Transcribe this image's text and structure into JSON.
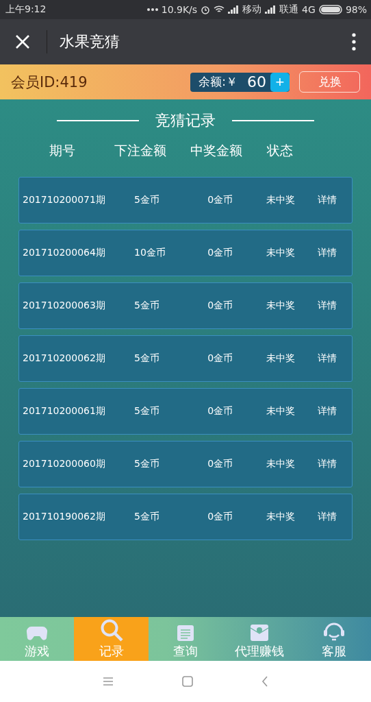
{
  "status_bar": {
    "time": "上午9:12",
    "speed": "10.9K/s",
    "carrier_1": "移动",
    "carrier_2": "联通",
    "network": "4G",
    "battery": "98%"
  },
  "header": {
    "title": "水果竞猜"
  },
  "member": {
    "id_label": "会员ID:419",
    "balance_label": "余额:￥",
    "balance": "60",
    "add": "+",
    "exchange": "兑换"
  },
  "section_title": "竞猜记录",
  "columns": [
    "期号",
    "下注金额",
    "中奖金额",
    "状态"
  ],
  "records": [
    {
      "period": "201710200071期",
      "bet": "5金币",
      "win": "0金币",
      "status": "未中奖",
      "detail": "详情"
    },
    {
      "period": "201710200064期",
      "bet": "10金币",
      "win": "0金币",
      "status": "未中奖",
      "detail": "详情"
    },
    {
      "period": "201710200063期",
      "bet": "5金币",
      "win": "0金币",
      "status": "未中奖",
      "detail": "详情"
    },
    {
      "period": "201710200062期",
      "bet": "5金币",
      "win": "0金币",
      "status": "未中奖",
      "detail": "详情"
    },
    {
      "period": "201710200061期",
      "bet": "5金币",
      "win": "0金币",
      "status": "未中奖",
      "detail": "详情"
    },
    {
      "period": "201710200060期",
      "bet": "5金币",
      "win": "0金币",
      "status": "未中奖",
      "detail": "详情"
    },
    {
      "period": "201710190062期",
      "bet": "5金币",
      "win": "0金币",
      "status": "未中奖",
      "detail": "详情"
    }
  ],
  "tabs": [
    {
      "label": "游戏",
      "selected": false
    },
    {
      "label": "记录",
      "selected": true
    },
    {
      "label": "查询",
      "selected": false
    },
    {
      "label": "代理赚钱",
      "selected": false
    },
    {
      "label": "客服",
      "selected": false
    }
  ]
}
